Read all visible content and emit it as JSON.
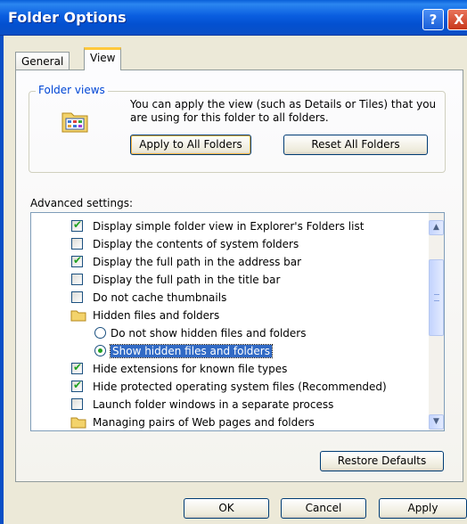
{
  "window": {
    "title": "Folder Options"
  },
  "titlebar": {
    "help_glyph": "?",
    "close_glyph": "X"
  },
  "tabs": [
    {
      "label": "General"
    },
    {
      "label": "View"
    }
  ],
  "folder_views": {
    "legend": "Folder views",
    "description": "You can apply the view (such as Details or Tiles) that you are using for this folder to all folders.",
    "apply_button": "Apply to All Folders",
    "reset_button": "Reset All Folders"
  },
  "advanced": {
    "label": "Advanced settings:",
    "items": [
      {
        "type": "checkbox",
        "checked": true,
        "label": "Display simple folder view in Explorer's Folders list"
      },
      {
        "type": "checkbox",
        "checked": false,
        "label": "Display the contents of system folders"
      },
      {
        "type": "checkbox",
        "checked": true,
        "label": "Display the full path in the address bar"
      },
      {
        "type": "checkbox",
        "checked": false,
        "label": "Display the full path in the title bar"
      },
      {
        "type": "checkbox",
        "checked": false,
        "label": "Do not cache thumbnails"
      },
      {
        "type": "folder",
        "label": "Hidden files and folders"
      },
      {
        "type": "radio",
        "checked": false,
        "label": "Do not show hidden files and folders"
      },
      {
        "type": "radio",
        "checked": true,
        "selected": true,
        "label": "Show hidden files and folders"
      },
      {
        "type": "checkbox",
        "checked": true,
        "label": "Hide extensions for known file types"
      },
      {
        "type": "checkbox",
        "checked": true,
        "label": "Hide protected operating system files (Recommended)"
      },
      {
        "type": "checkbox",
        "checked": false,
        "label": "Launch folder windows in a separate process"
      },
      {
        "type": "folder",
        "label": "Managing pairs of Web pages and folders"
      }
    ]
  },
  "buttons": {
    "restore_defaults": "Restore Defaults",
    "ok": "OK",
    "cancel": "Cancel",
    "apply": "Apply"
  },
  "colors": {
    "title_bar": "#0a5ee0",
    "selection": "#316ac5",
    "check": "#21a121",
    "legend": "#0046d5"
  }
}
